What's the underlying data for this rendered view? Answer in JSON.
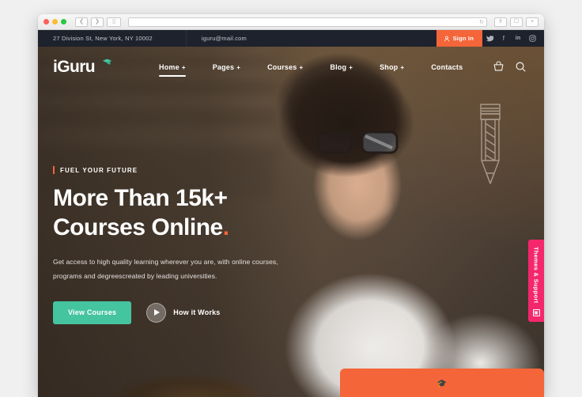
{
  "browser": {
    "traffic_lights": [
      "close",
      "minimize",
      "maximize"
    ],
    "back_icon": "chevron-left-icon",
    "forward_icon": "chevron-right-icon",
    "sidebar_icon": "sidebar-toggle-icon",
    "url_value": "",
    "url_placeholder": "",
    "reload_icon": "reload-icon",
    "share_icon": "share-icon",
    "tabs_icon": "show-tabs-icon",
    "newtab_icon": "new-tab-icon"
  },
  "topbar": {
    "address": "27 Division St, New York, NY 10002",
    "email": "iguru@mail.com",
    "signin_label": "Sign In",
    "signin_icon": "user-icon",
    "signin_color": "#f4653a",
    "socials": [
      {
        "name": "twitter-icon",
        "glyph": "✉"
      },
      {
        "name": "facebook-icon",
        "glyph": "f"
      },
      {
        "name": "linkedin-icon",
        "glyph": "in"
      },
      {
        "name": "instagram-icon",
        "glyph": "▣"
      }
    ]
  },
  "brand": {
    "prefix": "i",
    "name": "Guru",
    "dot_color": "#f4653a",
    "cap_color": "#45c4a0"
  },
  "nav": {
    "items": [
      {
        "label": "Home",
        "has_children": true,
        "active": true
      },
      {
        "label": "Pages",
        "has_children": true,
        "active": false
      },
      {
        "label": "Courses",
        "has_children": true,
        "active": false
      },
      {
        "label": "Blog",
        "has_children": true,
        "active": false
      },
      {
        "label": "Shop",
        "has_children": true,
        "active": false
      },
      {
        "label": "Contacts",
        "has_children": false,
        "active": false
      }
    ],
    "submenu_marker": "+",
    "actions": [
      {
        "name": "cart-icon"
      },
      {
        "name": "search-icon"
      }
    ]
  },
  "hero": {
    "eyebrow": "FUEL YOUR FUTURE",
    "headline_line1": "More Than 15k+",
    "headline_line2": "Courses Online",
    "headline_accent": ".",
    "subtext": "Get access to high quality learning wherever you are, with online courses, programs and degreescreated by leading universities.",
    "primary_button": "View Courses",
    "primary_button_color": "#45c4a0",
    "video_label": "How it Works",
    "play_icon": "play-icon",
    "doodle": "pencil-doodle-icon"
  },
  "support_tab": {
    "label": "Themes & Support",
    "color": "#f4276c",
    "icon": "monitor-icon"
  },
  "bottom_card": {
    "color": "#f4653a",
    "icon": "graduation-cap-icon"
  }
}
